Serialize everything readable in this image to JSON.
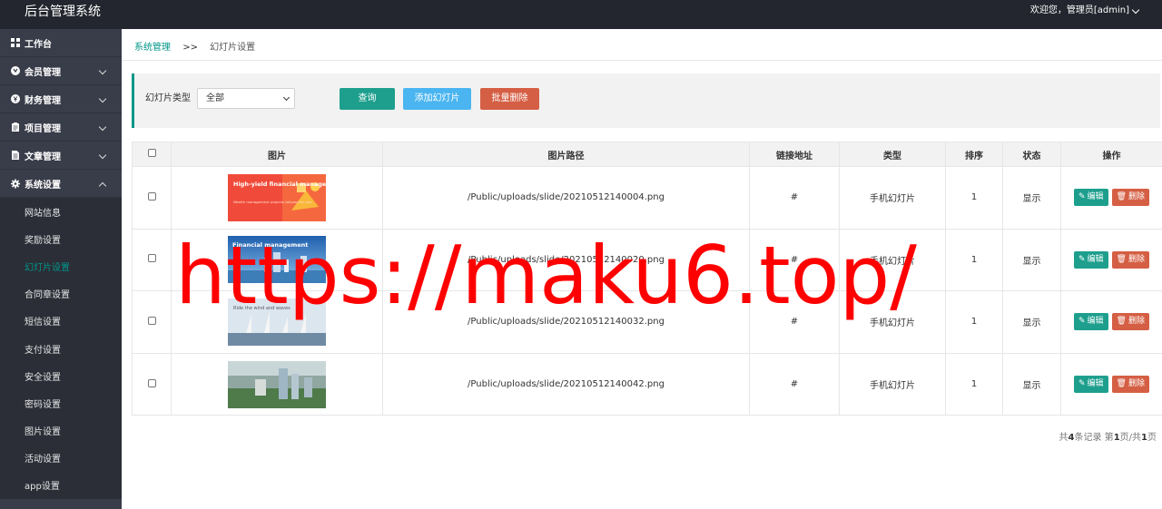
{
  "header": {
    "title": "后台管理系统",
    "user_greeting": "欢迎您，管理员[admin]"
  },
  "sidebar": {
    "items": [
      {
        "label": "工作台",
        "icon": "dashboard-icon"
      },
      {
        "label": "会员管理",
        "icon": "member-icon"
      },
      {
        "label": "财务管理",
        "icon": "finance-icon"
      },
      {
        "label": "项目管理",
        "icon": "clipboard-icon"
      },
      {
        "label": "文章管理",
        "icon": "document-icon"
      },
      {
        "label": "系统设置",
        "icon": "gear-icon"
      }
    ],
    "sub_items": [
      "网站信息",
      "奖励设置",
      "幻灯片设置",
      "合同章设置",
      "短信设置",
      "支付设置",
      "安全设置",
      "密码设置",
      "图片设置",
      "活动设置",
      "app设置"
    ],
    "active_sub": "幻灯片设置"
  },
  "breadcrumb": {
    "parent": "系统管理",
    "separator": ">>",
    "current": "幻灯片设置"
  },
  "filter": {
    "type_label": "幻灯片类型",
    "type_selected": "全部",
    "query_button": "查询",
    "add_button": "添加幻灯片",
    "batch_delete_button": "批量删除"
  },
  "table": {
    "headers": [
      "图片",
      "图片路径",
      "链接地址",
      "类型",
      "排序",
      "状态",
      "操作"
    ],
    "rows": [
      {
        "path": "/Public/uploads/slide/20210512140004.png",
        "link": "#",
        "type": "手机幻灯片",
        "sort": "1",
        "status": "显示",
        "thumb_text": "High-yield financial management",
        "thumb_sub": "Wealth management projects tailored for you"
      },
      {
        "path": "/Public/uploads/slide/20210512140020.png",
        "link": "#",
        "type": "手机幻灯片",
        "sort": "1",
        "status": "显示",
        "thumb_text": "Financial management",
        "thumb_sub": ""
      },
      {
        "path": "/Public/uploads/slide/20210512140032.png",
        "link": "#",
        "type": "手机幻灯片",
        "sort": "1",
        "status": "显示",
        "thumb_text": "Ride the wind and waves",
        "thumb_sub": ""
      },
      {
        "path": "/Public/uploads/slide/20210512140042.png",
        "link": "#",
        "type": "手机幻灯片",
        "sort": "1",
        "status": "显示",
        "thumb_text": "",
        "thumb_sub": ""
      }
    ],
    "edit_label": "编辑",
    "delete_label": "删除"
  },
  "pager": {
    "prefix": "共",
    "total": "4",
    "mid": "条记录 第",
    "page": "1",
    "mid2": "页/共",
    "pages": "1",
    "suffix": "页"
  },
  "watermark": "https://maku6.top/",
  "colors": {
    "accent": "#009688",
    "header_bg": "#23262e",
    "sidebar_bg": "#393d49",
    "add_button": "#4ab5f0",
    "danger": "#d55f44"
  }
}
